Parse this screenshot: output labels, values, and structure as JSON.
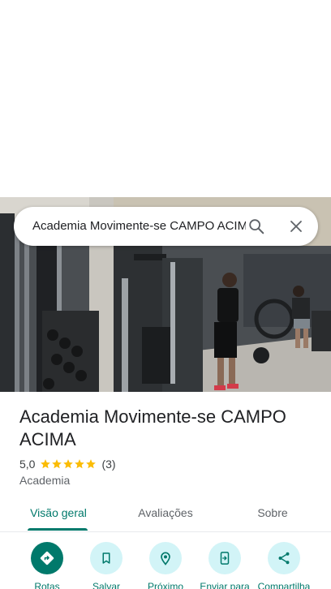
{
  "search": {
    "query": "Academia Movimente-se CAMPO ACIMA"
  },
  "place": {
    "name": "Academia Movimente-se CAMPO ACIMA",
    "rating_value": "5,0",
    "stars": 5,
    "review_count": "(3)",
    "category": "Academia"
  },
  "tabs": [
    {
      "label": "Visão geral",
      "active": true
    },
    {
      "label": "Avaliações",
      "active": false
    },
    {
      "label": "Sobre",
      "active": false
    }
  ],
  "actions": [
    {
      "label": "Rotas",
      "icon": "directions-icon"
    },
    {
      "label": "Salvar",
      "icon": "bookmark-icon"
    },
    {
      "label": "Próximo",
      "icon": "nearby-icon"
    },
    {
      "label": "Enviar para",
      "icon": "send-to-phone-icon"
    },
    {
      "label": "Compartilha",
      "icon": "share-icon"
    }
  ],
  "colors": {
    "accent": "#00796b",
    "action_bg": "#d2f4f7",
    "star": "#fbbc04"
  }
}
